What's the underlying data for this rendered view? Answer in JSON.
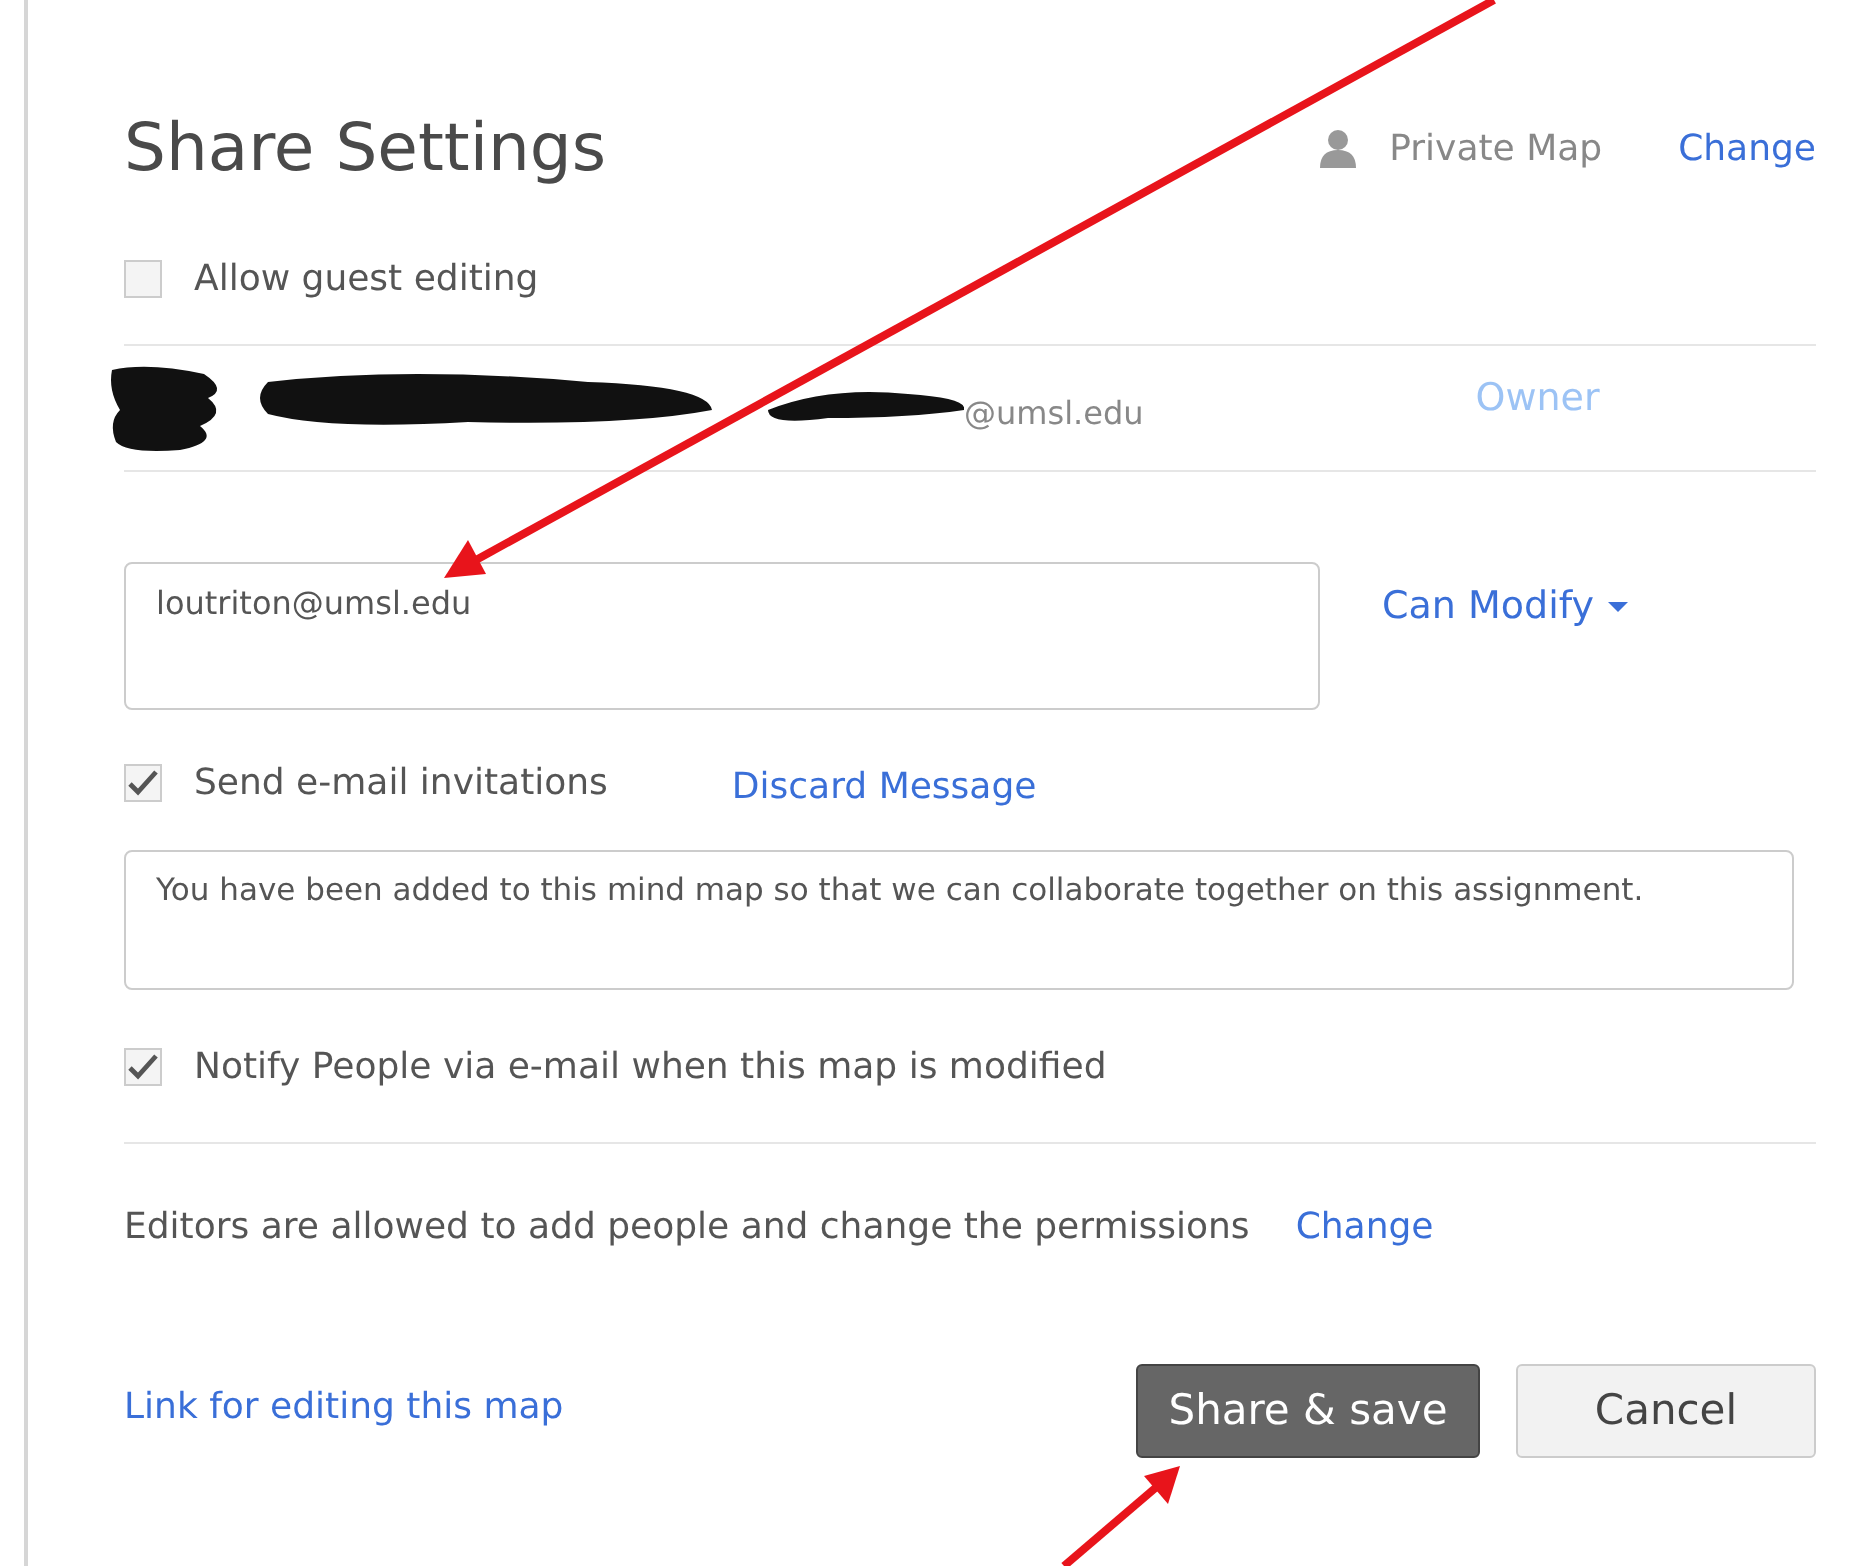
{
  "title": "Share Settings",
  "privacy": {
    "label": "Private Map",
    "action": "Change"
  },
  "guest_editing": {
    "label": "Allow guest editing",
    "checked": false
  },
  "members": [
    {
      "email_suffix": "@umsl.edu",
      "role": "Owner"
    }
  ],
  "invite": {
    "value": "loutriton@umsl.edu",
    "permission": "Can Modify"
  },
  "send_invitations": {
    "label": "Send e-mail invitations",
    "checked": true,
    "action": "Discard Message"
  },
  "message": {
    "value": "You have been added to this mind map so that we can collaborate together on this assignment."
  },
  "notify": {
    "label": "Notify People via e-mail when this map is modified",
    "checked": true
  },
  "permissions": {
    "text": "Editors are allowed to add people and change the permissions",
    "action": "Change"
  },
  "footer": {
    "link": "Link for editing this map",
    "buttons": [
      {
        "label": "Share & save",
        "kind": "primary"
      },
      {
        "label": "Cancel",
        "kind": "secondary"
      }
    ]
  }
}
